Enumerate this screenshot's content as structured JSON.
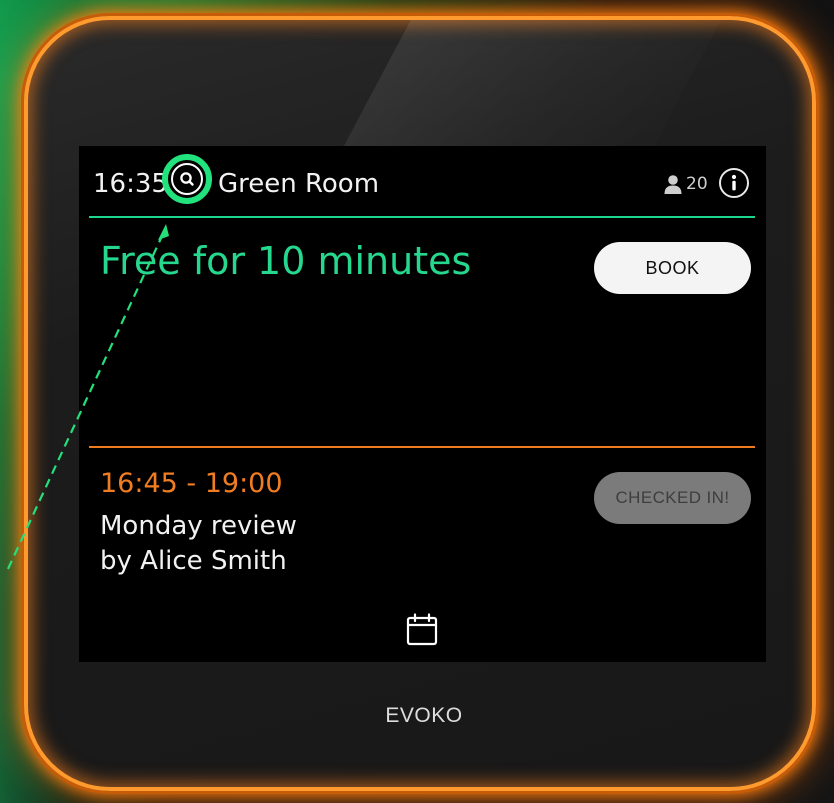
{
  "header": {
    "time": "16:35",
    "room_name": "Green Room",
    "capacity": "20"
  },
  "status": {
    "text": "Free for 10 minutes",
    "book_label": "BOOK"
  },
  "meeting": {
    "time_range": "16:45 - 19:00",
    "title": "Monday review",
    "organizer": "by Alice Smith",
    "checked_in_label": "CHECKED IN!"
  },
  "footer": {
    "brand": "EVOKO"
  },
  "icons": {
    "search": "search-icon",
    "person": "person-icon",
    "info": "info-icon",
    "calendar": "calendar-icon"
  },
  "colors": {
    "free_green": "#26d88e",
    "meeting_orange": "#f07d22",
    "device_glow": "#ff9a2e",
    "highlight_ring": "#22e27d"
  }
}
